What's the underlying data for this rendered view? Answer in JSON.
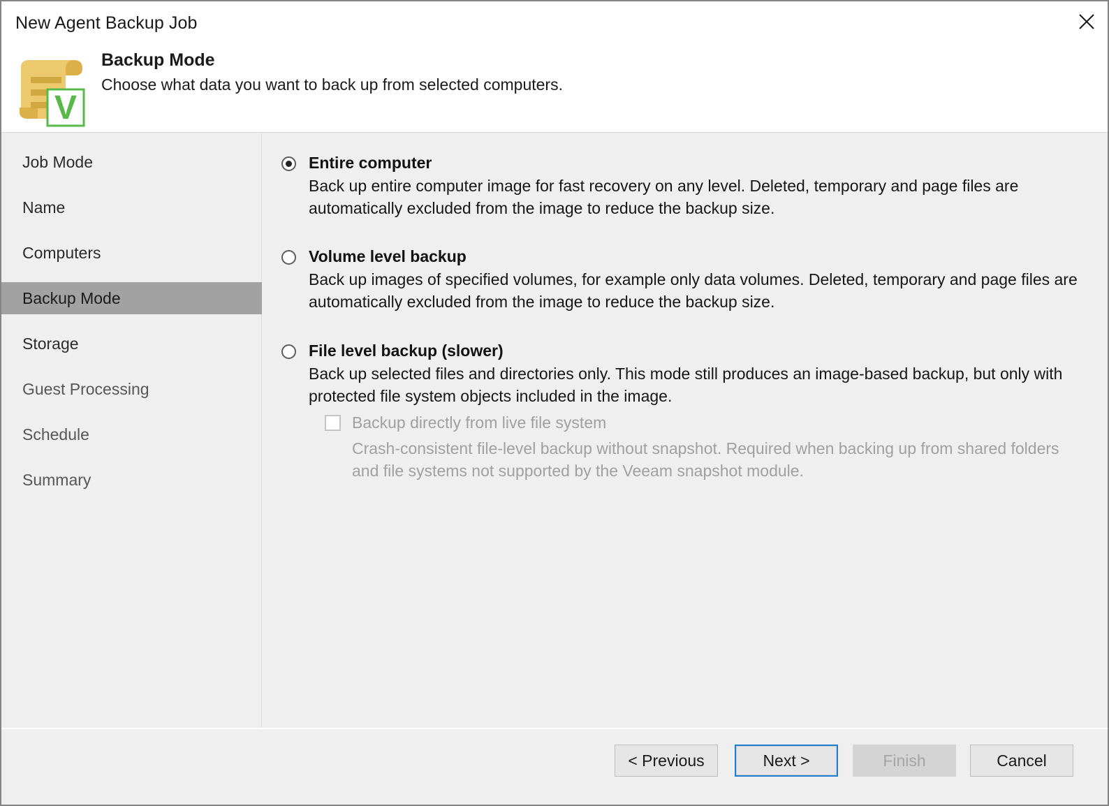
{
  "window": {
    "title": "New Agent Backup Job",
    "close_icon": "close-icon"
  },
  "header": {
    "icon": "backup-job-scroll-icon",
    "title": "Backup Mode",
    "subtitle": "Choose what data you want to back up from selected computers."
  },
  "sidebar": {
    "items": [
      {
        "label": "Job Mode",
        "active": false
      },
      {
        "label": "Name",
        "active": false
      },
      {
        "label": "Computers",
        "active": false
      },
      {
        "label": "Backup Mode",
        "active": true
      },
      {
        "label": "Storage",
        "active": false
      },
      {
        "label": "Guest Processing",
        "active": false
      },
      {
        "label": "Schedule",
        "active": false
      },
      {
        "label": "Summary",
        "active": false
      }
    ],
    "highlight_color": "#a2a2a2"
  },
  "main": {
    "options": [
      {
        "label": "Entire computer",
        "description": "Back up entire computer image for fast recovery on any level. Deleted, temporary and page files are automatically excluded from the image to reduce the backup size.",
        "selected": true
      },
      {
        "label": "Volume level backup",
        "description": "Back up images of specified volumes, for example only data volumes. Deleted, temporary and page files are automatically excluded from the image to reduce the backup size.",
        "selected": false
      },
      {
        "label": "File level backup (slower)",
        "description": "Back up selected files and directories only. This mode still produces an image-based backup, but only with protected file system objects included in the image.",
        "selected": false
      }
    ],
    "sub_option": {
      "label": "Backup directly from live file system",
      "description": "Crash-consistent file-level backup without snapshot. Required when backing up from shared folders and file systems not supported by the Veeam snapshot module.",
      "checked": false,
      "enabled": false
    }
  },
  "footer": {
    "buttons": [
      {
        "label": "< Previous",
        "state": "normal"
      },
      {
        "label": "Next >",
        "state": "focused"
      },
      {
        "label": "Finish",
        "state": "disabled"
      },
      {
        "label": "Cancel",
        "state": "normal"
      }
    ]
  }
}
